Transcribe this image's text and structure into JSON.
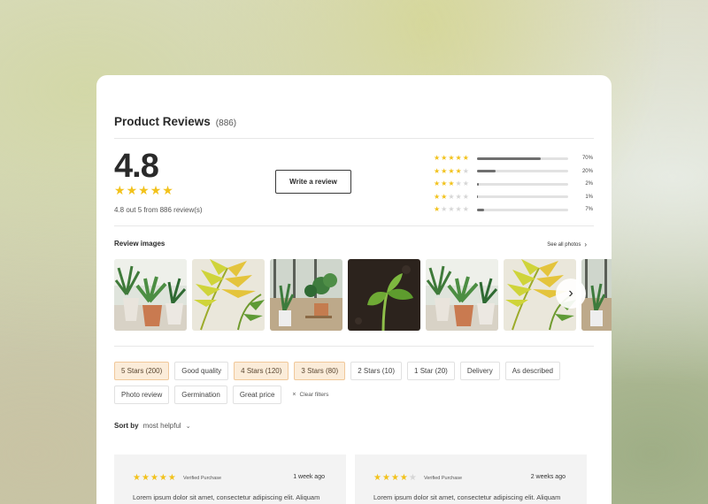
{
  "header": {
    "title": "Product Reviews",
    "count": "(886)"
  },
  "summary": {
    "rating": "4.8",
    "stars_filled": 5,
    "subtext": "4.8 out 5 from 886 review(s)",
    "write_button": "Write a review"
  },
  "distribution": [
    {
      "stars": 5,
      "percent": 70,
      "label": "70%"
    },
    {
      "stars": 4,
      "percent": 20,
      "label": "20%"
    },
    {
      "stars": 3,
      "percent": 2,
      "label": "2%"
    },
    {
      "stars": 2,
      "percent": 1,
      "label": "1%"
    },
    {
      "stars": 1,
      "percent": 7,
      "label": "7%"
    }
  ],
  "images": {
    "title": "Review images",
    "see_all": "See all photos",
    "items": [
      "plant-photo",
      "palm-leaf-photo",
      "plants-window-photo",
      "seedling-photo",
      "plant-photo",
      "palm-leaf-photo",
      "plants-window-photo"
    ]
  },
  "filters": [
    {
      "label": "5 Stars (200)",
      "active": true
    },
    {
      "label": "Good quality",
      "active": false
    },
    {
      "label": "4 Stars (120)",
      "active": true
    },
    {
      "label": "3 Stars (80)",
      "active": true
    },
    {
      "label": "2 Stars (10)",
      "active": false
    },
    {
      "label": "1 Star (20)",
      "active": false
    },
    {
      "label": "Delivery",
      "active": false
    },
    {
      "label": "As described",
      "active": false
    },
    {
      "label": "Photo review",
      "active": false
    },
    {
      "label": "Germination",
      "active": false
    },
    {
      "label": "Great price",
      "active": false
    }
  ],
  "clear_filters": "Clear filters",
  "sort": {
    "label": "Sort by",
    "value": "most helpful"
  },
  "reviews": [
    {
      "stars": 5,
      "verified": "Verified Purchase",
      "time": "1 week ago",
      "text": "Lorem ipsum dolor sit amet, consectetur adipiscing elit. Aliquam"
    },
    {
      "stars": 4,
      "verified": "Verified Purchase",
      "time": "2 weeks ago",
      "text": "Lorem ipsum dolor sit amet, consectetur adipiscing elit. Aliquam"
    }
  ],
  "colors": {
    "star": "#f2c21b",
    "star_off": "#d6d6d6",
    "chip_active_bg": "#fbecd9",
    "bar": "#6f6f6f"
  }
}
